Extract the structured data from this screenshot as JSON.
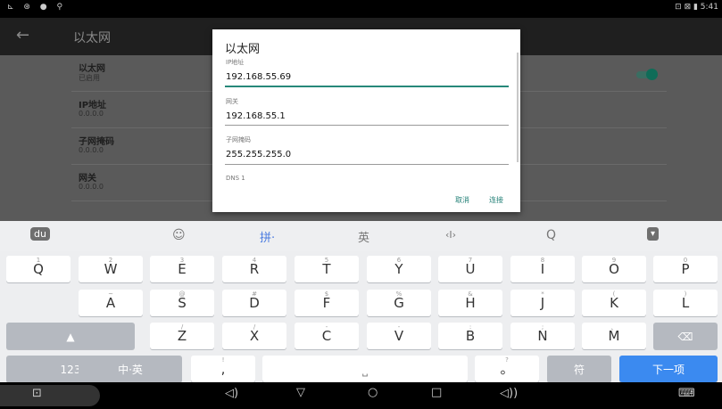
{
  "status": {
    "left_icons": "⊾ ⊛ ● ⚲",
    "right": "⊡ ⊠ ▮ 5:41"
  },
  "appbar": {
    "back_icon": "←",
    "title": "以太网"
  },
  "list": [
    {
      "title": "以太网",
      "subtitle": "已启用"
    },
    {
      "title": "IP地址",
      "subtitle": "0.0.0.0"
    },
    {
      "title": "子网掩码",
      "subtitle": "0.0.0.0"
    },
    {
      "title": "网关",
      "subtitle": "0.0.0.0"
    }
  ],
  "dialog": {
    "title": "以太网",
    "fields": [
      {
        "label": "IP地址",
        "value": "192.168.55.69"
      },
      {
        "label": "网关",
        "value": "192.168.55.1"
      },
      {
        "label": "子网掩码",
        "value": "255.255.255.0"
      },
      {
        "label": "DNS 1",
        "value": ""
      }
    ],
    "cancel": "取消",
    "connect": "连接"
  },
  "keyboard": {
    "tools": [
      "du",
      "☺",
      "拼·",
      "英",
      "‹I›",
      "Q",
      "▾"
    ],
    "row1": [
      {
        "m": "Q",
        "h": "1"
      },
      {
        "m": "W",
        "h": "2"
      },
      {
        "m": "E",
        "h": "3"
      },
      {
        "m": "R",
        "h": "4"
      },
      {
        "m": "T",
        "h": "5"
      },
      {
        "m": "Y",
        "h": "6"
      },
      {
        "m": "U",
        "h": "7"
      },
      {
        "m": "I",
        "h": "8"
      },
      {
        "m": "O",
        "h": "9"
      },
      {
        "m": "P",
        "h": "0"
      }
    ],
    "row2": [
      {
        "m": "A",
        "h": "~"
      },
      {
        "m": "S",
        "h": "@"
      },
      {
        "m": "D",
        "h": "#"
      },
      {
        "m": "F",
        "h": "$"
      },
      {
        "m": "G",
        "h": "%"
      },
      {
        "m": "H",
        "h": "&"
      },
      {
        "m": "J",
        "h": "*"
      },
      {
        "m": "K",
        "h": "("
      },
      {
        "m": "L",
        "h": ")"
      }
    ],
    "row3": [
      {
        "m": "▲",
        "h": ""
      },
      {
        "m": "Z",
        "h": "/"
      },
      {
        "m": "X",
        "h": "/"
      },
      {
        "m": "C",
        "h": "-"
      },
      {
        "m": "V",
        "h": "-"
      },
      {
        "m": "B",
        "h": ":"
      },
      {
        "m": "N",
        "h": ";"
      },
      {
        "m": "M",
        "h": "、"
      },
      {
        "m": "⌫",
        "h": ""
      }
    ],
    "row4": [
      {
        "m": "123",
        "h": ""
      },
      {
        "m": "中·英",
        "h": ""
      },
      {
        "m": ",",
        "h": "!"
      },
      {
        "m": "⎵",
        "h": ""
      },
      {
        "m": "。",
        "h": "?"
      },
      {
        "m": "符",
        "h": ""
      },
      {
        "m": "下一项",
        "h": ""
      }
    ]
  },
  "nav": [
    "⊡",
    "◁)",
    "▽",
    "○",
    "□",
    "◁))",
    "⌨"
  ],
  "colors": {
    "accent": "#27887a",
    "blue": "#3b8af0",
    "dim": "#5a5a5a"
  }
}
